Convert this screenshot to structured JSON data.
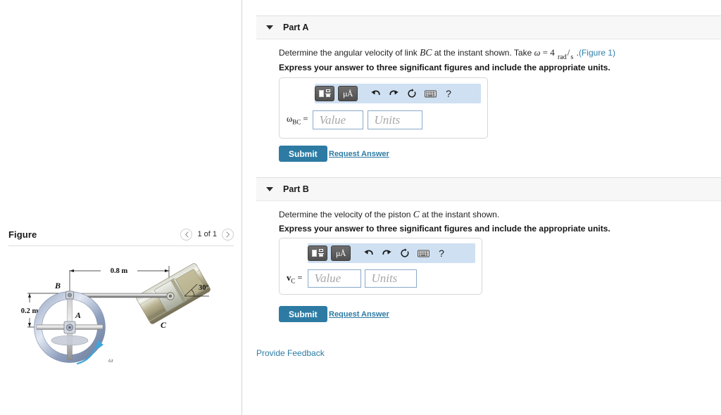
{
  "figure_panel": {
    "title": "Figure",
    "pager": {
      "prev_icon": "chevron-left-icon",
      "next_icon": "chevron-right-icon",
      "count_label": "1 of 1"
    },
    "diagram": {
      "labels": {
        "dim_horizontal": "0.8 m",
        "dim_vertical": "0.2 m",
        "point_b": "B",
        "point_a": "A",
        "point_c": "C",
        "angle": "30°",
        "omega": "ω"
      }
    }
  },
  "parts": [
    {
      "id": "part-a",
      "header_label": "Part A",
      "caret_icon": "caret-down-icon",
      "prompt": {
        "text_1": "Determine the angular velocity of link ",
        "math_1": "BC",
        "text_2": " at the instant shown. Take ",
        "greek_1": "ω",
        "text_3": " = 4 ",
        "unit_num": "rad",
        "unit_den": "s",
        "text_4": " .",
        "figure_link": "(Figure 1)"
      },
      "instruction": "Express your answer to three significant figures and include the appropriate units.",
      "toolbar": {
        "template_button": "math-template-icon",
        "units_button": "μÅ",
        "undo_icon": "undo-icon",
        "redo_icon": "redo-icon",
        "reset_icon": "reset-icon",
        "keyboard_icon": "keyboard-icon",
        "help_label": "?"
      },
      "answer": {
        "variable": "ω",
        "subscript": "BC",
        "equals": "=",
        "value_placeholder": "Value",
        "units_placeholder": "Units"
      },
      "submit_label": "Submit",
      "request_answer_label": "Request Answer"
    },
    {
      "id": "part-b",
      "header_label": "Part B",
      "caret_icon": "caret-down-icon",
      "prompt": {
        "text_1": "Determine the velocity of the piston ",
        "math_1": "C",
        "text_2": " at the instant shown.",
        "math_2": "",
        "text_3": "",
        "figure_link": ""
      },
      "instruction": "Express your answer to three significant figures and include the appropriate units.",
      "toolbar": {
        "template_button": "math-template-icon",
        "units_button": "μÅ",
        "undo_icon": "undo-icon",
        "redo_icon": "redo-icon",
        "reset_icon": "reset-icon",
        "keyboard_icon": "keyboard-icon",
        "help_label": "?"
      },
      "answer": {
        "variable": "v",
        "subscript": "C",
        "equals": "=",
        "value_placeholder": "Value",
        "units_placeholder": "Units"
      },
      "submit_label": "Submit",
      "request_answer_label": "Request Answer"
    }
  ],
  "footer": {
    "provide_feedback_label": "Provide Feedback"
  },
  "colors": {
    "accent": "#2d7ba3",
    "link": "#2d7fa8",
    "toolbar_bg": "#cfe0f2",
    "band_bg": "#f7f7f7",
    "input_border": "#8aa9c9"
  }
}
